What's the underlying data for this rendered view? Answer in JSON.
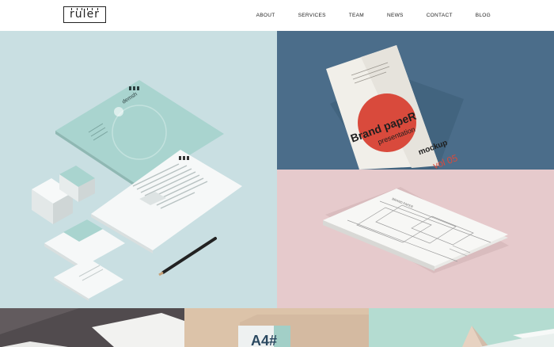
{
  "brand": {
    "logo_text": "ruler"
  },
  "nav": {
    "items": [
      {
        "label": "ABOUT"
      },
      {
        "label": "SERVICES"
      },
      {
        "label": "TEAM"
      },
      {
        "label": "NEWS"
      },
      {
        "label": "CONTACT"
      },
      {
        "label": "BLOG"
      }
    ]
  },
  "portfolio": {
    "tiles": [
      {
        "brand_name": "demsh"
      },
      {
        "line1": "Brand papeR",
        "line2": "presentation",
        "line3": "mockup",
        "line4": "vol 05"
      },
      {
        "title": "BRAND PAPER"
      },
      {},
      {
        "label": "A4#"
      },
      {}
    ]
  },
  "colors": {
    "mint_background": "#c9dfe2",
    "blue_background": "#4b6d8a",
    "pink_background": "#e6cacc",
    "accent_red": "#d94a3c",
    "text_dark": "#222222"
  }
}
